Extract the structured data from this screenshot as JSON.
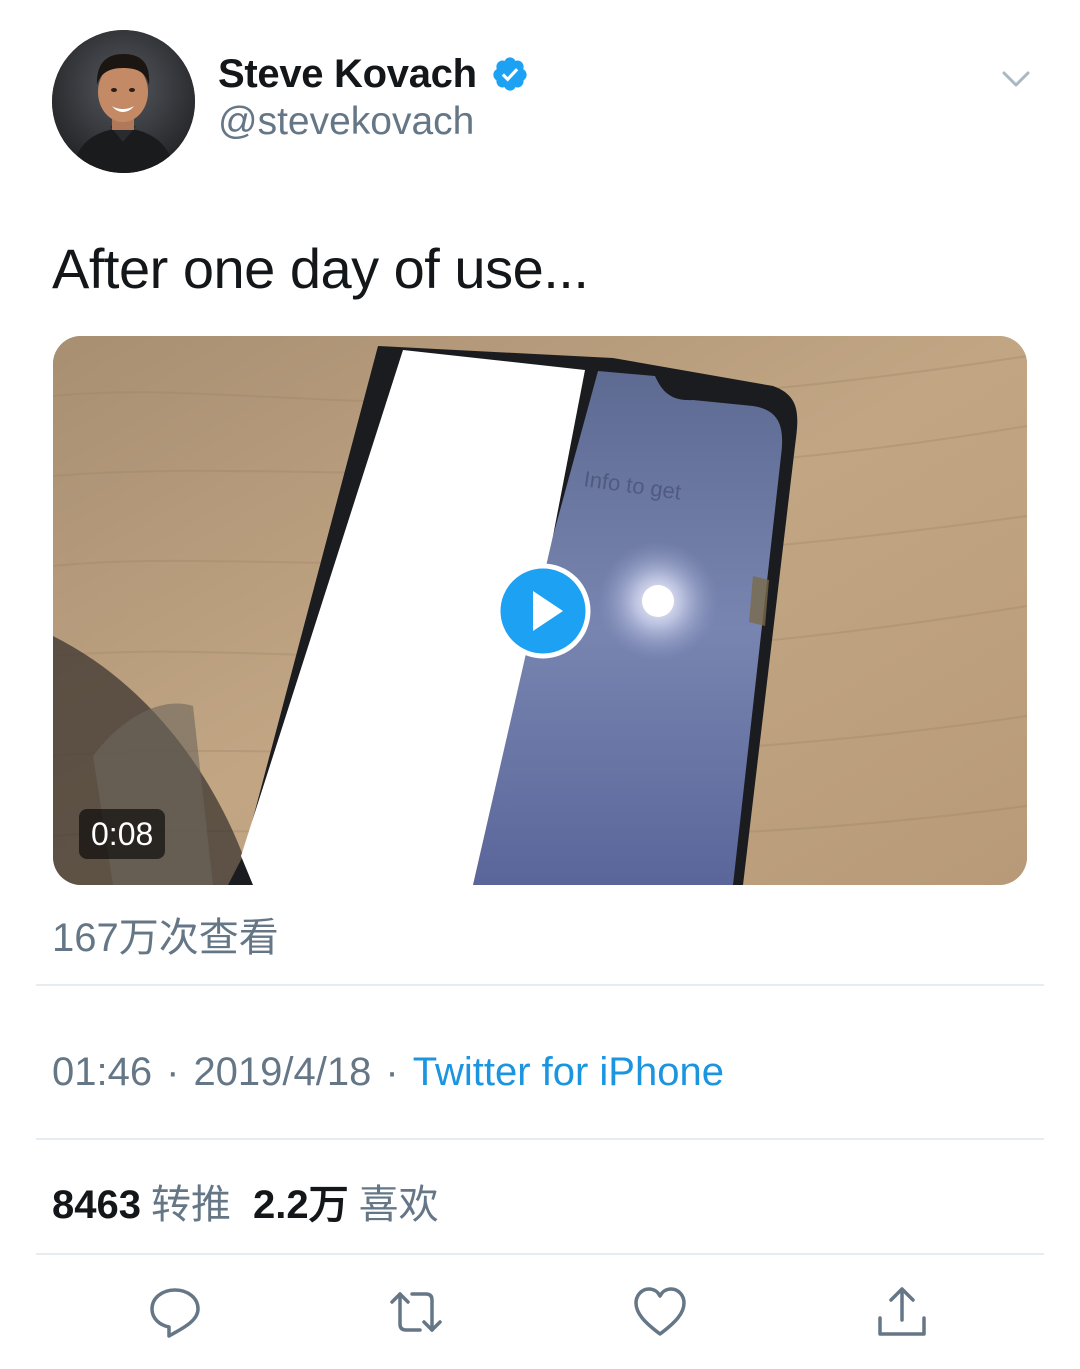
{
  "author": {
    "display_name": "Steve Kovach",
    "handle": "@stevekovach",
    "verified": true
  },
  "tweet": {
    "text": "After one day of use..."
  },
  "media": {
    "duration": "0:08",
    "views": "167万次查看",
    "screen_text": "Info to get"
  },
  "meta": {
    "time": "01:46",
    "separator": "·",
    "date": "2019/4/18",
    "source": "Twitter for iPhone"
  },
  "stats": {
    "retweets_count": "8463",
    "retweets_label": "转推",
    "likes_count": "2.2万",
    "likes_label": "喜欢"
  },
  "colors": {
    "accent": "#1b95e0",
    "verified": "#1da1f2",
    "secondary_text": "#657786",
    "primary_text": "#14171a",
    "divider": "#e6ecf0"
  },
  "icons": {
    "more": "chevron-down-icon",
    "verified": "verified-badge-icon",
    "play": "play-icon",
    "reply": "reply-icon",
    "retweet": "retweet-icon",
    "like": "heart-icon",
    "share": "share-icon"
  }
}
